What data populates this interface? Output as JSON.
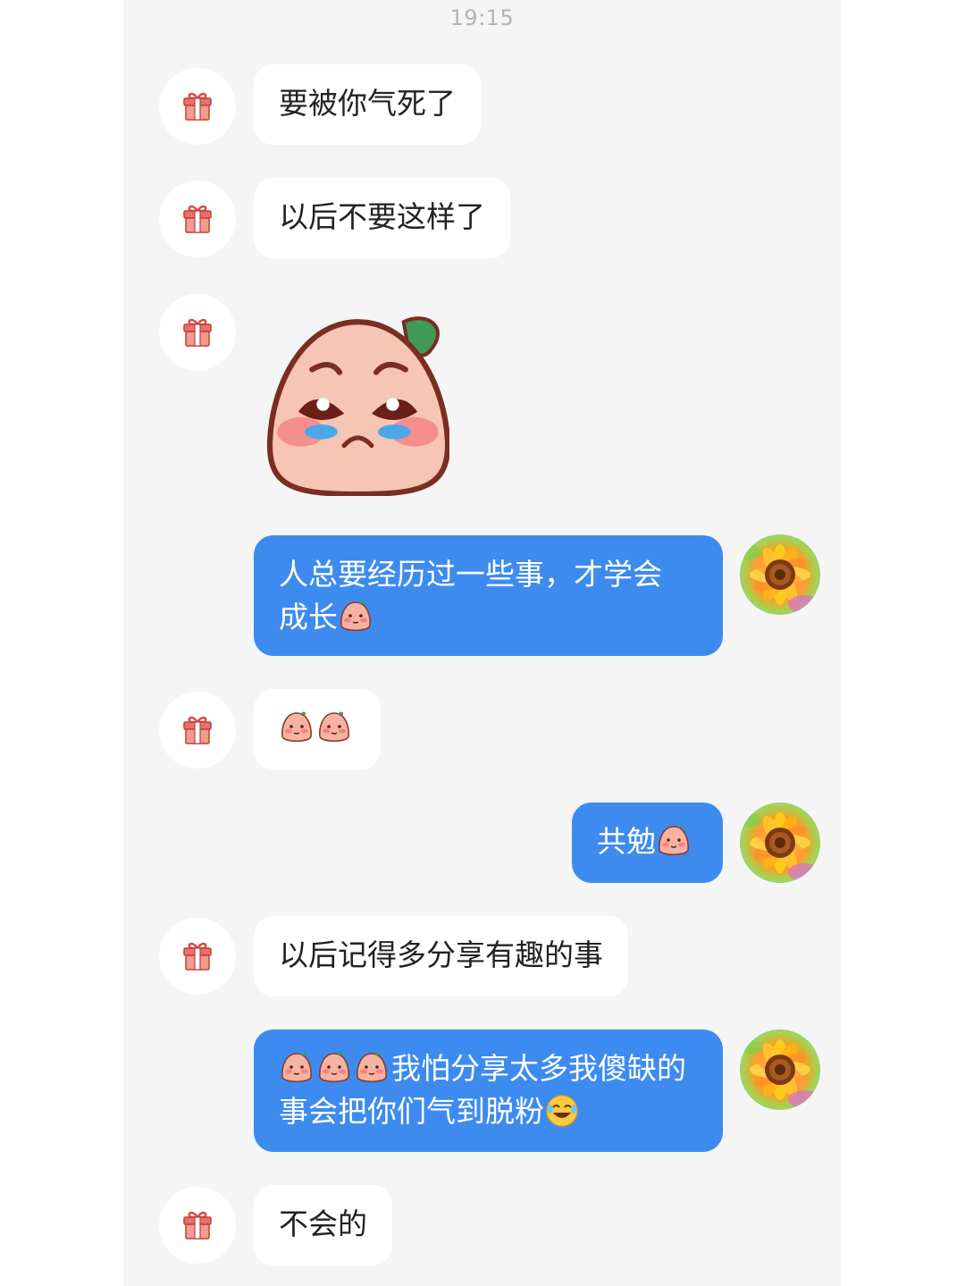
{
  "chat": {
    "time": "19:15",
    "messages": [
      {
        "from": "other",
        "text": "要被你气死了"
      },
      {
        "from": "other",
        "text": "以后不要这样了"
      },
      {
        "from": "other",
        "type": "sticker",
        "sticker": "sad-peach-sticker"
      },
      {
        "from": "me",
        "text": "人总要经历过一些事，才学会",
        "text2": "成长"
      },
      {
        "from": "other",
        "type": "emoji-only",
        "emojis": [
          "peach-sad-emoji",
          "peach-scream-emoji"
        ]
      },
      {
        "from": "me",
        "text": "共勉"
      },
      {
        "from": "other",
        "text": "以后记得多分享有趣的事"
      },
      {
        "from": "me",
        "text": "我怕分享太多我傻缺的",
        "text2": "事会把你们气到脱粉"
      },
      {
        "from": "other",
        "text": "不会的"
      }
    ]
  },
  "colors": {
    "background": "#f5f5f5",
    "incoming_bubble": "#ffffff",
    "outgoing_bubble": "#3d8bef",
    "gift": "#e2574c"
  },
  "icons": {
    "other_avatar": "gift-icon",
    "my_avatar": "sunflower-avatar"
  }
}
